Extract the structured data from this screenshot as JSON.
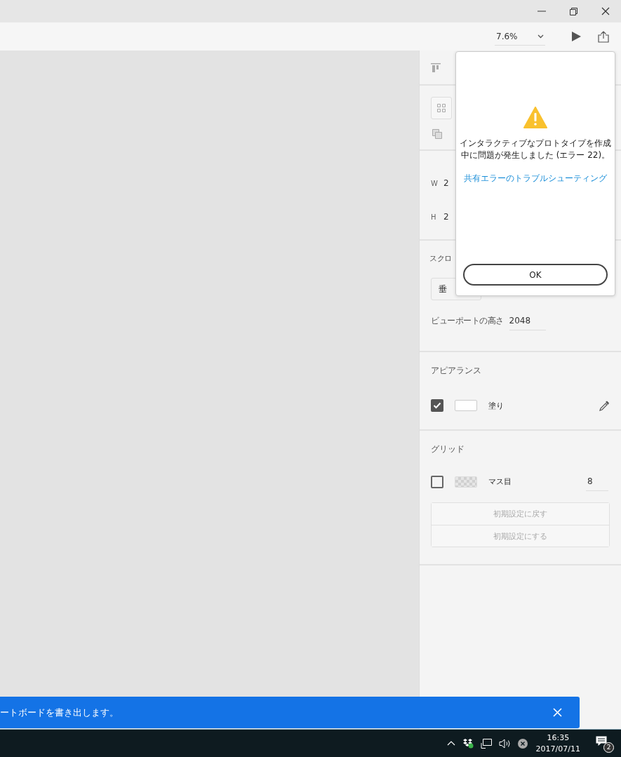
{
  "toolbar": {
    "zoom": "7.6%"
  },
  "panel": {
    "size": {
      "width_label": "W",
      "width_value": "2",
      "height_label": "H",
      "height_value": "2"
    },
    "scroll": {
      "label": "スクロ",
      "mode": "垂",
      "viewport_label": "ビューポートの高さ",
      "viewport_value": "2048"
    },
    "appearance": {
      "title": "アピアランス",
      "checked": true,
      "label": "塗り"
    },
    "grid": {
      "title": "グリッド",
      "checked": false,
      "label": "マス目",
      "value": "8",
      "buttons": [
        "初期設定に戻す",
        "初期設定にする"
      ]
    }
  },
  "dialog": {
    "message": "インタラクティブなプロトタイプを作成中に問題が発生しました (エラー 22)。",
    "link": "共有エラーのトラブルシューティング",
    "button": "OK"
  },
  "toast": {
    "message": "ートボードを書き出します。"
  },
  "taskbar": {
    "time": "16:35",
    "date": "2017/07/11",
    "notifications": "2"
  }
}
